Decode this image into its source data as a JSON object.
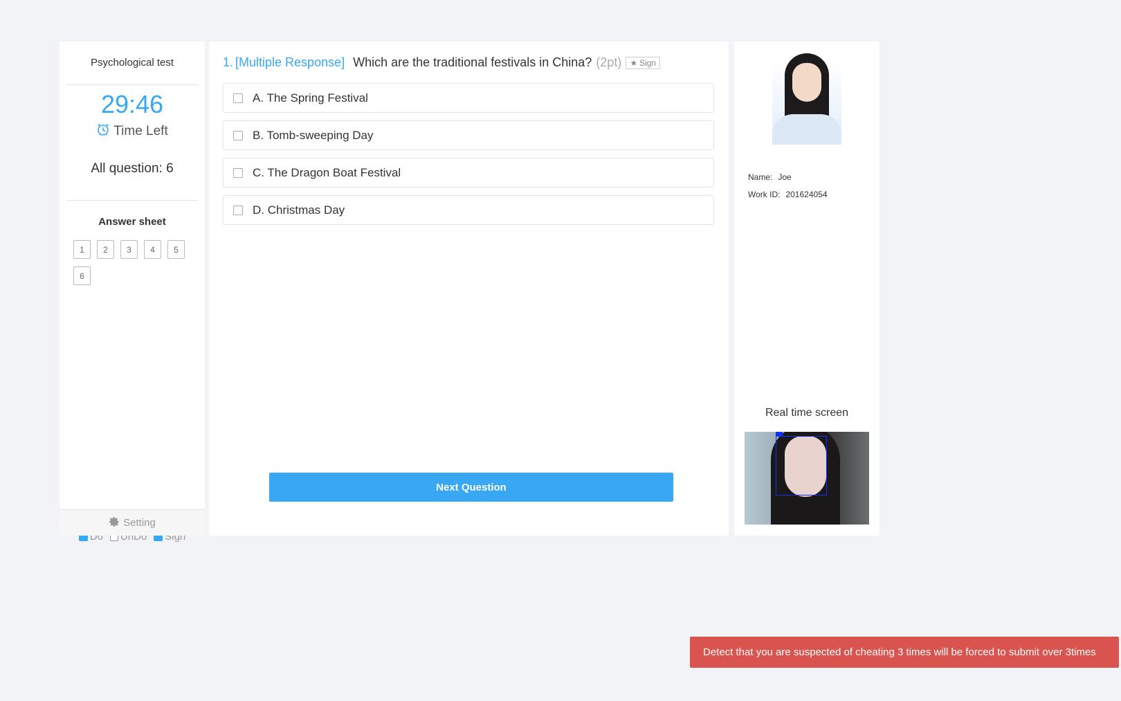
{
  "sidebar": {
    "test_title": "Psychological test",
    "timer": "29:46",
    "time_left_label": "Time Left",
    "time_icon": "alarm-clock-icon",
    "all_question_label": "All question: 6",
    "answer_sheet_title": "Answer sheet",
    "answer_sheet_items": [
      "1",
      "2",
      "3",
      "4",
      "5",
      "6"
    ],
    "legend": {
      "do": "Do",
      "undo": "UnDo",
      "sign": "Sign"
    },
    "setting_label": "Setting",
    "setting_icon": "gear-icon"
  },
  "question": {
    "number": "1.",
    "type": "[Multiple Response]",
    "text": "Which are the traditional festivals in China?",
    "points": "(2pt)",
    "sign_label": "Sign",
    "sign_icon": "star-icon",
    "options": [
      {
        "label": "A. The Spring Festival",
        "checked": false
      },
      {
        "label": "B. Tomb-sweeping Day",
        "checked": false
      },
      {
        "label": "C. The Dragon Boat Festival",
        "checked": false
      },
      {
        "label": "D. Christmas Day",
        "checked": false
      }
    ],
    "next_button": "Next Question"
  },
  "profile": {
    "name_label": "Name:",
    "name": "Joe",
    "work_id_label": "Work ID:",
    "work_id": "201624054",
    "realtime_title": "Real time screen"
  },
  "alert": {
    "message": "Detect that you are suspected of cheating 3 times will be forced to submit over 3times"
  },
  "colors": {
    "accent": "#38a8f5",
    "alert": "#d9534f",
    "background": "#f2f3f7",
    "sign_star": "#ff8c1a"
  }
}
